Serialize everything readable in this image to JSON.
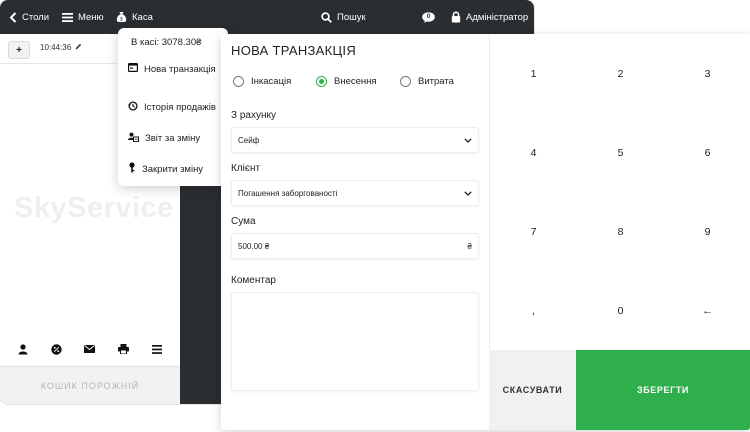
{
  "topbar": {
    "tables_label": "Столи",
    "menu_label": "Меню",
    "cash_label": "Каса",
    "search_label": "Пошук",
    "notifications_count": "0",
    "user_label": "Адміністратор"
  },
  "order": {
    "chip_label": "+",
    "time": "10:44:36"
  },
  "watermark": "SkyService",
  "cart": {
    "empty_label": "КОШИК ПОРОЖНІЙ"
  },
  "cash_menu": {
    "balance": "В касі: 3078.30₴",
    "items": [
      {
        "label": "Нова транзакція",
        "icon": "transaction-icon"
      },
      {
        "label": "Історія продажів",
        "icon": "history-icon"
      },
      {
        "label": "Звіт за зміну",
        "icon": "report-icon"
      },
      {
        "label": "Закрити зміну",
        "icon": "key-icon"
      }
    ]
  },
  "modal": {
    "title": "НОВА ТРАНЗАКЦІЯ",
    "transaction_types": [
      {
        "label": "Інкасація",
        "selected": false
      },
      {
        "label": "Внесення",
        "selected": true
      },
      {
        "label": "Витрата",
        "selected": false
      }
    ],
    "account": {
      "label": "З рахунку",
      "value": "Сейф"
    },
    "client": {
      "label": "Клієнт",
      "value": "Погашення заборгованості"
    },
    "amount": {
      "label": "Сума",
      "value": "500.00 ₴",
      "currency": "₴"
    },
    "comment": {
      "label": "Коментар",
      "value": ""
    }
  },
  "keypad": {
    "keys": [
      "1",
      "2",
      "3",
      "4",
      "5",
      "6",
      "7",
      "8",
      "9",
      ",",
      "0",
      "←"
    ],
    "cancel_label": "СКАСУВАТИ",
    "save_label": "ЗБЕРЕГТИ"
  },
  "colors": {
    "topbar": "#2b2e31",
    "accent_green": "#2fae4c",
    "cancel_bg": "#f1f1f1"
  }
}
